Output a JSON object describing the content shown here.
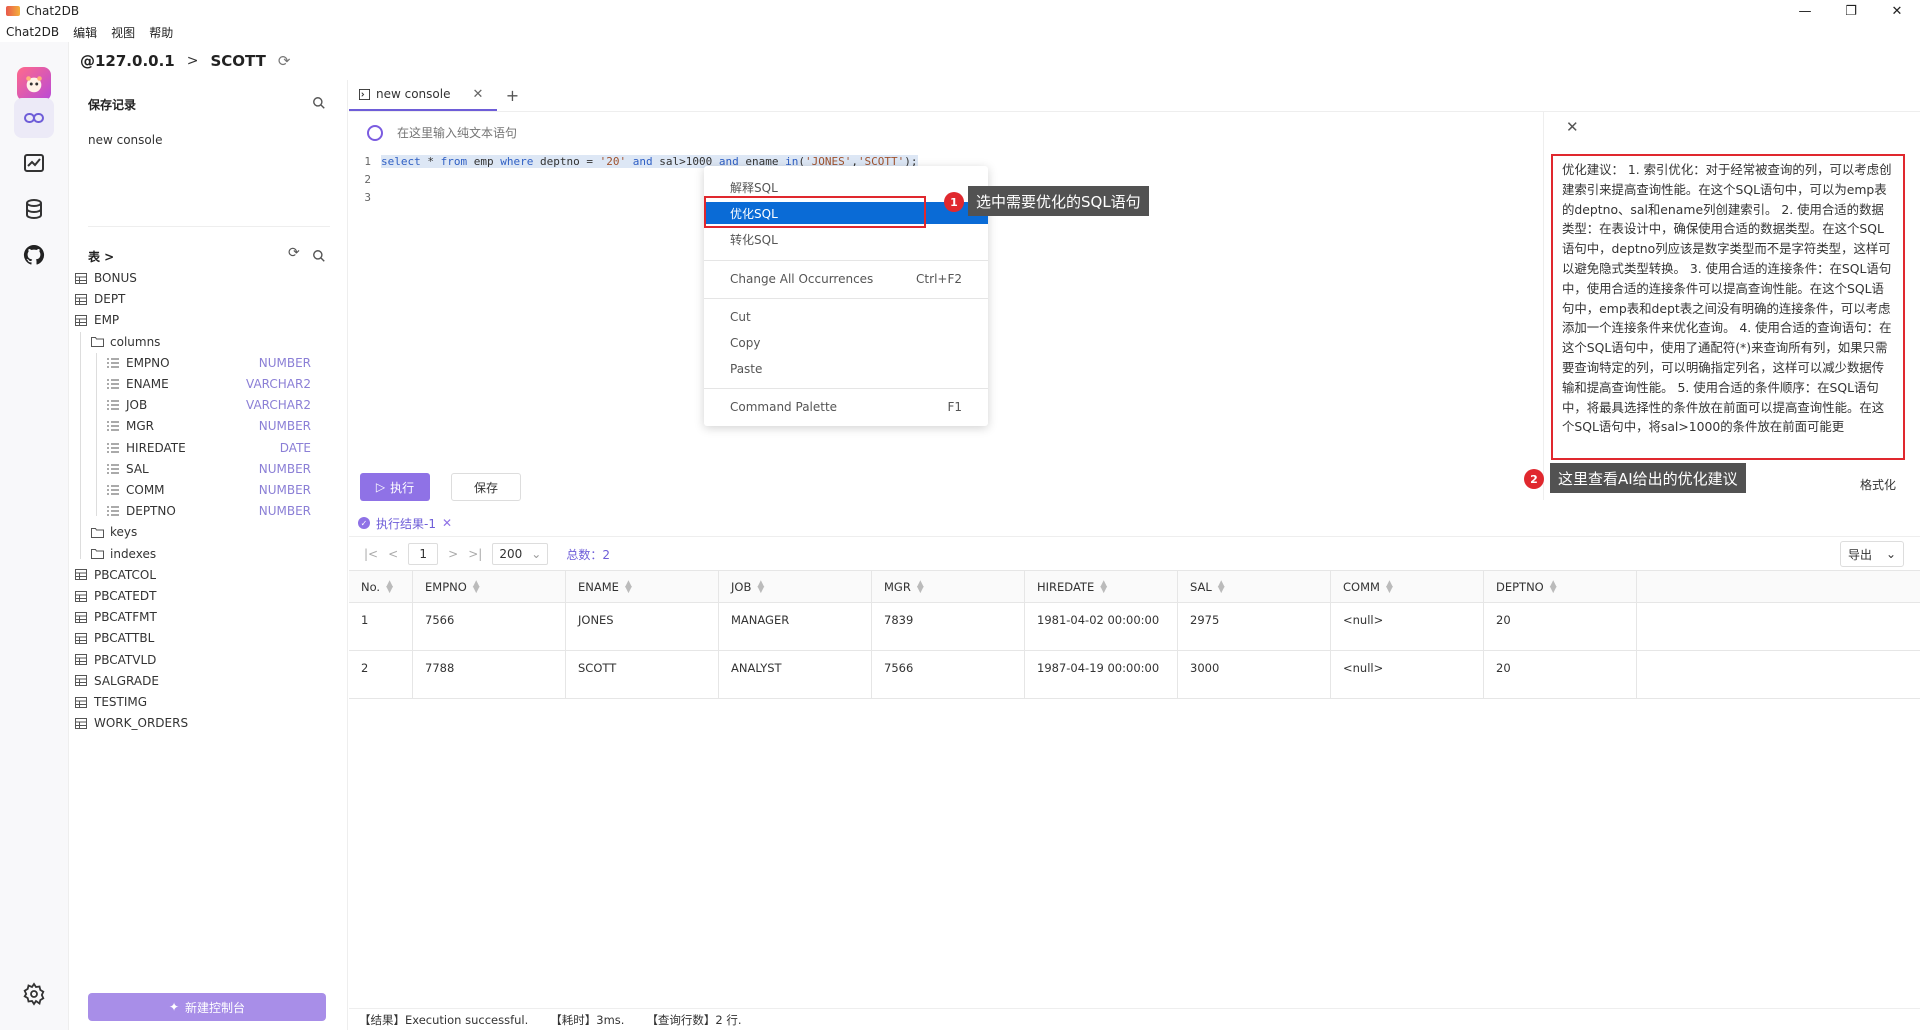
{
  "window": {
    "title": "Chat2DB",
    "controls": [
      "—",
      "❐",
      "✕"
    ]
  },
  "menu": [
    "Chat2DB",
    "编辑",
    "视图",
    "帮助"
  ],
  "connection": {
    "host": "@127.0.0.1",
    "separator": ">",
    "database": "SCOTT"
  },
  "sidebar": {
    "saved_title": "保存记录",
    "saved_items": [
      "new console"
    ],
    "tables_title": "表 >",
    "tables_before": [
      "BONUS",
      "DEPT",
      "EMP"
    ],
    "columns_folder": "columns",
    "columns": [
      {
        "name": "EMPNO",
        "type": "NUMBER"
      },
      {
        "name": "ENAME",
        "type": "VARCHAR2"
      },
      {
        "name": "JOB",
        "type": "VARCHAR2"
      },
      {
        "name": "MGR",
        "type": "NUMBER"
      },
      {
        "name": "HIREDATE",
        "type": "DATE"
      },
      {
        "name": "SAL",
        "type": "NUMBER"
      },
      {
        "name": "COMM",
        "type": "NUMBER"
      },
      {
        "name": "DEPTNO",
        "type": "NUMBER"
      }
    ],
    "keys_folder": "keys",
    "indexes_folder": "indexes",
    "tables_after": [
      "PBCATCOL",
      "PBCATEDT",
      "PBCATFMT",
      "PBCATTBL",
      "PBCATVLD",
      "SALGRADE",
      "TESTIMG",
      "WORK_ORDERS"
    ],
    "new_console_label": "新建控制台"
  },
  "tabs": [
    {
      "label": "new console"
    }
  ],
  "ai_input": {
    "placeholder": "在这里输入纯文本语句"
  },
  "editor": {
    "line_numbers": [
      "1",
      "2",
      "3"
    ],
    "sql_parts": [
      {
        "t": "select",
        "k": "kw"
      },
      {
        "t": " * ",
        "k": ""
      },
      {
        "t": "from",
        "k": "kw"
      },
      {
        "t": " emp ",
        "k": ""
      },
      {
        "t": "where",
        "k": "kw"
      },
      {
        "t": " deptno = ",
        "k": ""
      },
      {
        "t": "'20'",
        "k": "str"
      },
      {
        "t": " and ",
        "k": "kw"
      },
      {
        "t": "sal>1000 ",
        "k": ""
      },
      {
        "t": "and",
        "k": "kw"
      },
      {
        "t": " ename ",
        "k": ""
      },
      {
        "t": "in",
        "k": "kw"
      },
      {
        "t": "(",
        "k": ""
      },
      {
        "t": "'JONES'",
        "k": "str"
      },
      {
        "t": ",",
        "k": ""
      },
      {
        "t": "'SCOTT'",
        "k": "str"
      },
      {
        "t": ");",
        "k": ""
      }
    ]
  },
  "context_menu": {
    "items": [
      {
        "label": "解释SQL",
        "shortcut": ""
      },
      {
        "label": "优化SQL",
        "shortcut": ""
      },
      {
        "label": "转化SQL",
        "shortcut": ""
      },
      {
        "label": "Change All Occurrences",
        "shortcut": "Ctrl+F2"
      },
      {
        "label": "Cut",
        "shortcut": ""
      },
      {
        "label": "Copy",
        "shortcut": ""
      },
      {
        "label": "Paste",
        "shortcut": ""
      },
      {
        "label": "Command Palette",
        "shortcut": "F1"
      }
    ],
    "highlighted": "优化SQL"
  },
  "annotations": [
    {
      "number": "1",
      "text": "选中需要优化的SQL语句"
    },
    {
      "number": "2",
      "text": "这里查看AI给出的优化建议"
    }
  ],
  "ai_panel": {
    "text": "优化建议： 1. 索引优化：对于经常被查询的列，可以考虑创建索引来提高查询性能。在这个SQL语句中，可以为emp表的deptno、sal和ename列创建索引。 2. 使用合适的数据类型：在表设计中，确保使用合适的数据类型。在这个SQL语句中，deptno列应该是数字类型而不是字符类型，这样可以避免隐式类型转换。 3. 使用合适的连接条件：在SQL语句中，使用合适的连接条件可以提高查询性能。在这个SQL语句中，emp表和dept表之间没有明确的连接条件，可以考虑添加一个连接条件来优化查询。 4. 使用合适的查询语句：在这个SQL语句中，使用了通配符(*)来查询所有列，如果只需要查询特定的列，可以明确指定列名，这样可以减少数据传输和提高查询性能。 5. 使用合适的条件顺序：在SQL语句中，将最具选择性的条件放在前面可以提高查询性能。在这个SQL语句中，将sal>1000的条件放在前面可能更"
  },
  "format_label": "格式化",
  "actions": {
    "run": "执行",
    "save": "保存"
  },
  "results": {
    "tab_label": "执行结果-1",
    "page": "1",
    "page_size": "200",
    "total": "总数：2",
    "export_label": "导出",
    "columns": [
      "No.",
      "EMPNO",
      "ENAME",
      "JOB",
      "MGR",
      "HIREDATE",
      "SAL",
      "COMM",
      "DEPTNO"
    ],
    "rows": [
      [
        "1",
        "7566",
        "JONES",
        "MANAGER",
        "7839",
        "1981-04-02 00:00:00",
        "2975",
        "<null>",
        "20"
      ],
      [
        "2",
        "7788",
        "SCOTT",
        "ANALYST",
        "7566",
        "1987-04-19 00:00:00",
        "3000",
        "<null>",
        "20"
      ]
    ]
  },
  "status": {
    "result": "【结果】Execution successful.",
    "time": "【耗时】3ms.",
    "rows": "【查询行数】2 行."
  }
}
